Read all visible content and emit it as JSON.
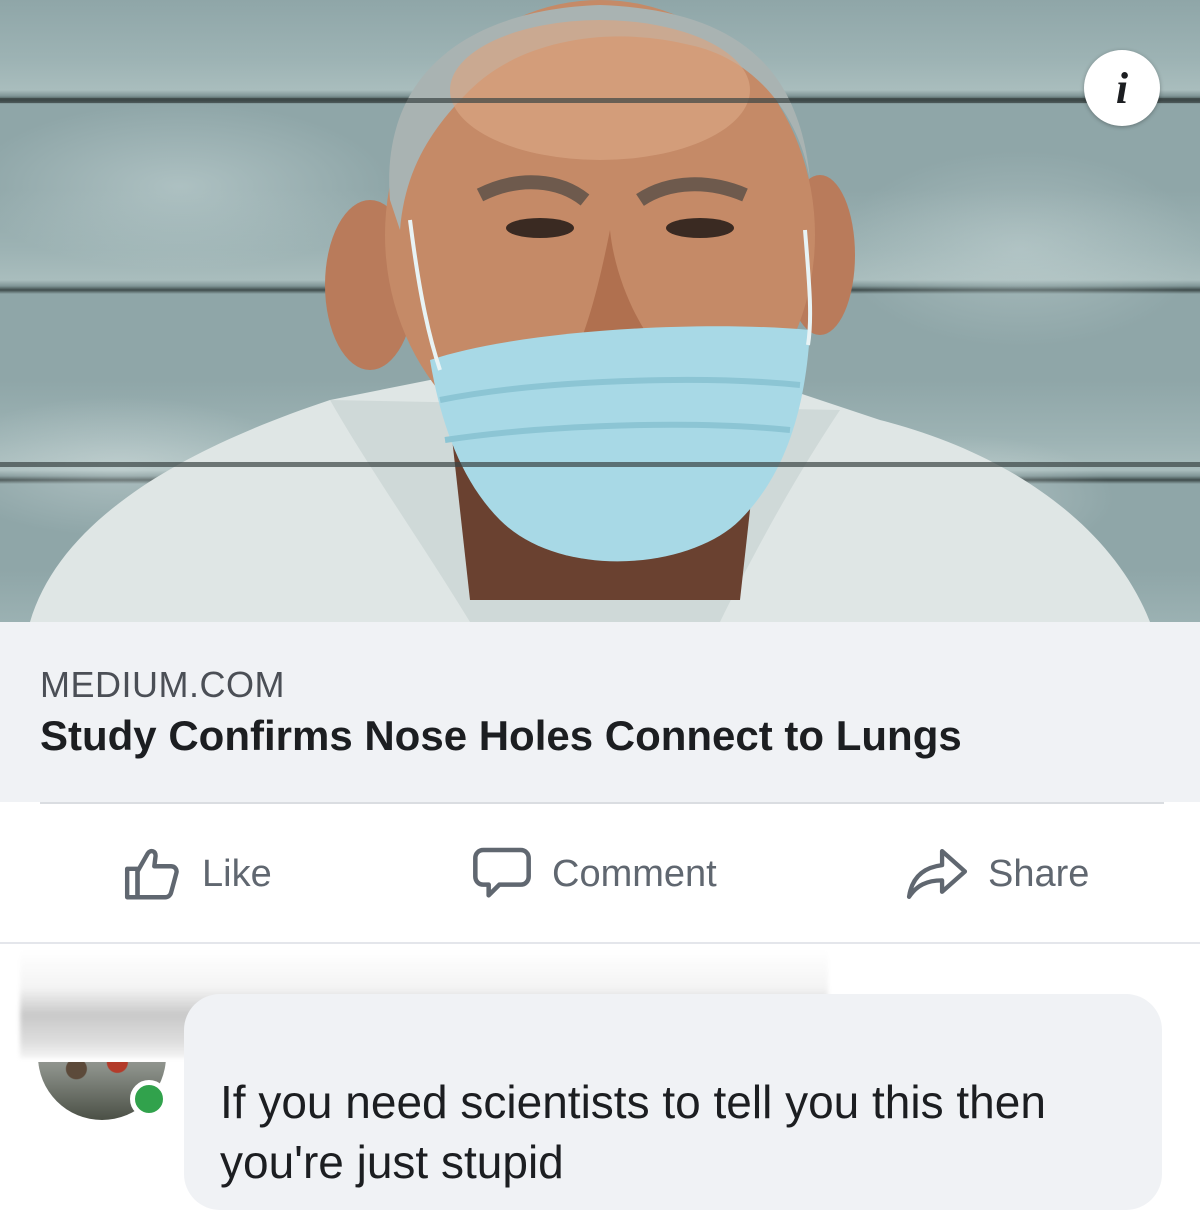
{
  "link_preview": {
    "image_alt": "Older man wearing a blue surgical mask below his nose in front of a weathered wooden wall",
    "info_icon": "info-icon",
    "domain": "MEDIUM.COM",
    "title": "Study Confirms Nose Holes Connect to Lungs"
  },
  "actions": {
    "like": {
      "label": "Like",
      "icon": "thumbs-up-icon"
    },
    "comment": {
      "label": "Comment",
      "icon": "speech-bubble-icon"
    },
    "share": {
      "label": "Share",
      "icon": "share-arrow-icon"
    }
  },
  "comment": {
    "author_redacted": true,
    "online": true,
    "text": "If you need scientists to tell you this then you're just stupid"
  },
  "colors": {
    "text_primary": "#1c1e21",
    "text_secondary": "#606770",
    "meta_background": "#f0f2f5",
    "presence_green": "#31a24c"
  }
}
